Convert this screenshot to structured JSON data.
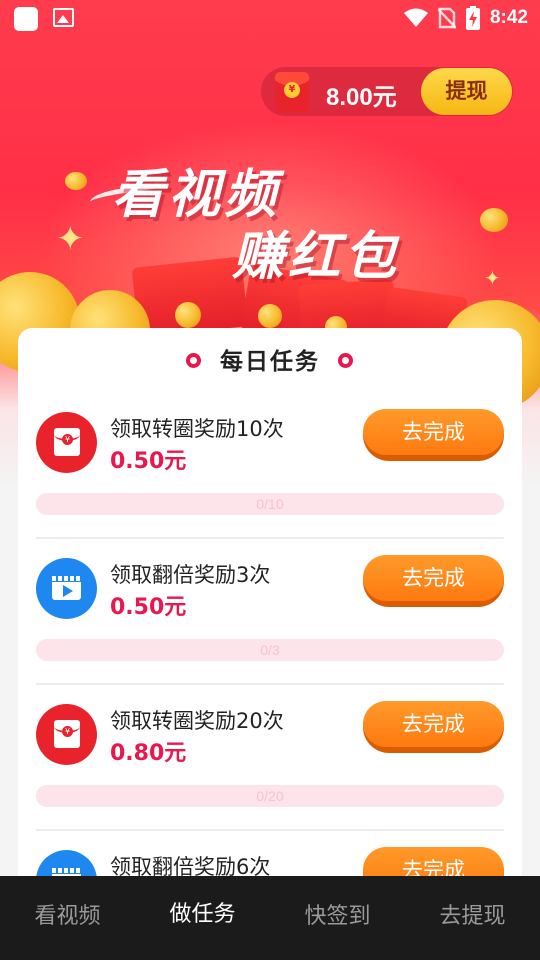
{
  "status_bar": {
    "time": "8:42"
  },
  "balance": {
    "amount": "8.00元",
    "withdraw_label": "提现"
  },
  "headline": {
    "line1": "看视频",
    "line2": "赚红包"
  },
  "card": {
    "title": "每日任务",
    "tasks": [
      {
        "name": "领取转圈奖励10次",
        "reward": "0.50元",
        "button": "去完成",
        "progress": "0/10",
        "icon": "red-envelope-icon",
        "fraction": 0
      },
      {
        "name": "领取翻倍奖励3次",
        "reward": "0.50元",
        "button": "去完成",
        "progress": "0/3",
        "icon": "video-clapper-icon",
        "fraction": 0
      },
      {
        "name": "领取转圈奖励20次",
        "reward": "0.80元",
        "button": "去完成",
        "progress": "0/20",
        "icon": "red-envelope-icon",
        "fraction": 0
      },
      {
        "name": "领取翻倍奖励6次",
        "reward": "",
        "button": "去完成",
        "progress": "",
        "icon": "video-clapper-icon",
        "fraction": 0
      }
    ]
  },
  "nav": {
    "items": [
      "看视频",
      "做任务",
      "快签到",
      "去提现"
    ],
    "active": "做任务"
  },
  "colors": {
    "accent": "#e8174d",
    "button": "#ff8a1c",
    "hero": "#ff3c4e",
    "nav_bg": "#1b1b1b"
  }
}
